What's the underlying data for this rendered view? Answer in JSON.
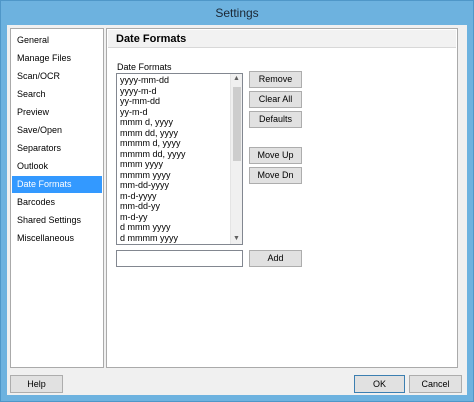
{
  "window": {
    "title": "Settings"
  },
  "sidebar": {
    "items": [
      {
        "label": "General",
        "selected": false
      },
      {
        "label": "Manage Files",
        "selected": false
      },
      {
        "label": "Scan/OCR",
        "selected": false
      },
      {
        "label": "Search",
        "selected": false
      },
      {
        "label": "Preview",
        "selected": false
      },
      {
        "label": "Save/Open",
        "selected": false
      },
      {
        "label": "Separators",
        "selected": false
      },
      {
        "label": "Outlook",
        "selected": false
      },
      {
        "label": "Date Formats",
        "selected": true
      },
      {
        "label": "Barcodes",
        "selected": false
      },
      {
        "label": "Shared Settings",
        "selected": false
      },
      {
        "label": "Miscellaneous",
        "selected": false
      }
    ]
  },
  "panel": {
    "title": "Date Formats",
    "list_label": "Date Formats",
    "formats": [
      "yyyy-mm-dd",
      "yyyy-m-d",
      "yy-mm-dd",
      "yy-m-d",
      "mmm d, yyyy",
      "mmm dd, yyyy",
      "mmmm d, yyyy",
      "mmmm dd, yyyy",
      "mmm yyyy",
      "mmmm yyyy",
      "mm-dd-yyyy",
      "m-d-yyyy",
      "mm-dd-yy",
      "m-d-yy",
      "d mmm yyyy",
      "d mmmm yyyy"
    ],
    "buttons": {
      "remove": "Remove",
      "clear_all": "Clear All",
      "defaults": "Defaults",
      "move_up": "Move Up",
      "move_dn": "Move Dn",
      "add": "Add"
    },
    "new_format_value": ""
  },
  "footer": {
    "help": "Help",
    "ok": "OK",
    "cancel": "Cancel"
  }
}
